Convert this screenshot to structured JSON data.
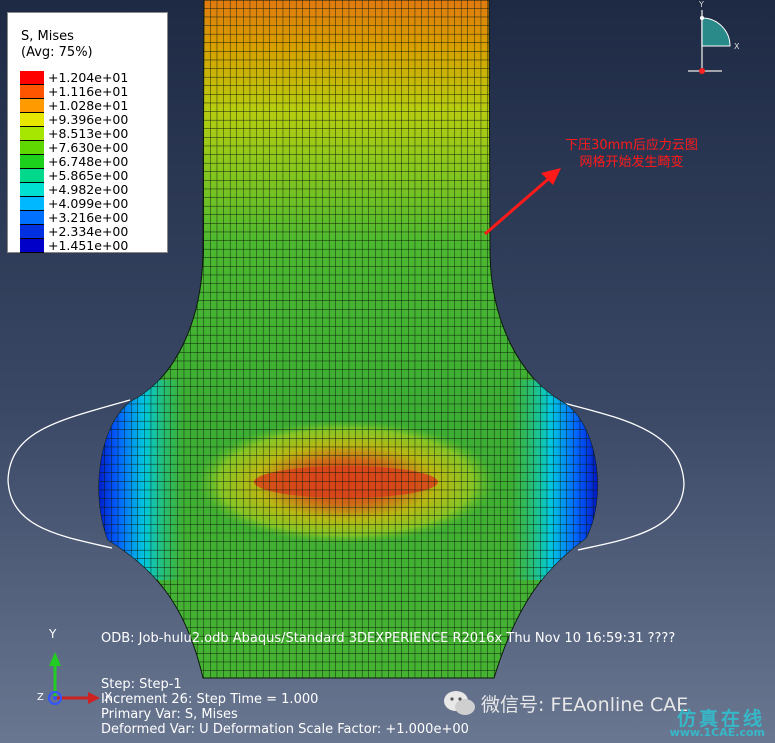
{
  "legend": {
    "title_line1": "S, Mises",
    "title_line2": "(Avg: 75%)",
    "entries": [
      {
        "value": "+1.204e+01",
        "color": "#ff0000"
      },
      {
        "value": "+1.116e+01",
        "color": "#ff5500"
      },
      {
        "value": "+1.028e+01",
        "color": "#ff9a00"
      },
      {
        "value": "+9.396e+00",
        "color": "#e6e600"
      },
      {
        "value": "+8.513e+00",
        "color": "#a6e600"
      },
      {
        "value": "+7.630e+00",
        "color": "#5ed800"
      },
      {
        "value": "+6.748e+00",
        "color": "#1cd01c"
      },
      {
        "value": "+5.865e+00",
        "color": "#00d88c"
      },
      {
        "value": "+4.982e+00",
        "color": "#00e0d0"
      },
      {
        "value": "+4.099e+00",
        "color": "#00b8ff"
      },
      {
        "value": "+3.216e+00",
        "color": "#0070ff"
      },
      {
        "value": "+2.334e+00",
        "color": "#0030e0"
      },
      {
        "value": "+1.451e+00",
        "color": "#0000c8"
      }
    ]
  },
  "annotation": {
    "line1": "下压30mm后应力云图",
    "line2": "网格开始发生畸变"
  },
  "info": {
    "odb": "ODB: Job-hulu2.odb    Abaqus/Standard 3DEXPERIENCE R2016x    Thu Nov 10 16:59:31 ????",
    "step": "Step: Step-1",
    "increment": "Increment     26: Step Time =    1.000",
    "primary_var": "Primary Var: S, Mises",
    "deformed_var": "Deformed Var: U   Deformation Scale Factor: +1.000e+00"
  },
  "triad": {
    "y": "Y",
    "x": "X",
    "z": "Z",
    "small_y": "Y",
    "small_x": "X"
  },
  "watermark": {
    "text": "微信号: FEAonline  CAE",
    "logo_text": "仿真在线",
    "logo_url": "www.1CAE.com"
  },
  "icons": {
    "wechat": "wechat-icon"
  }
}
